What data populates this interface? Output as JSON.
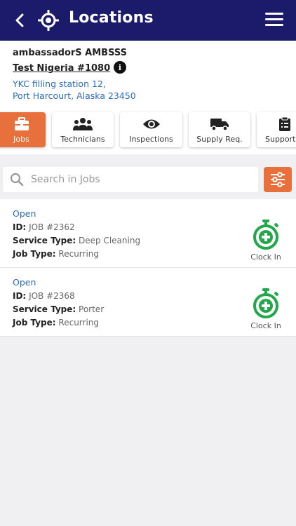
{
  "header": {
    "title": "Locations",
    "back_icon": "chevron-left-icon",
    "location_icon": "crosshair-location-icon",
    "menu_icon": "hamburger-menu-icon",
    "bg_color": "#1c1a6b"
  },
  "location": {
    "company": "ambassadorS AMBSSS",
    "site_name": "Test Nigeria #1080",
    "info_glyph": "i",
    "address_line1": "YKC filling station 12,",
    "address_line2": "Port Harcourt, Alaska 23450"
  },
  "tabs": [
    {
      "label": "Jobs",
      "icon": "briefcase-icon",
      "active": true
    },
    {
      "label": "Technicians",
      "icon": "users-icon",
      "active": false
    },
    {
      "label": "Inspections",
      "icon": "eye-icon",
      "active": false
    },
    {
      "label": "Supply Req.",
      "icon": "truck-icon",
      "active": false
    },
    {
      "label": "Support",
      "icon": "clipboard-icon",
      "active": false
    }
  ],
  "search": {
    "placeholder": "Search in Jobs",
    "value": ""
  },
  "accent_color": "#e8703c",
  "jobs": [
    {
      "status": "Open",
      "id_label": "ID:",
      "id_value": "JOB #2362",
      "service_label": "Service Type:",
      "service_value": "Deep Cleaning",
      "jobtype_label": "Job Type:",
      "jobtype_value": "Recurring",
      "action_label": "Clock In"
    },
    {
      "status": "Open",
      "id_label": "ID:",
      "id_value": "JOB #2368",
      "service_label": "Service Type:",
      "service_value": "Porter",
      "jobtype_label": "Job Type:",
      "jobtype_value": "Recurring",
      "action_label": "Clock In"
    }
  ]
}
